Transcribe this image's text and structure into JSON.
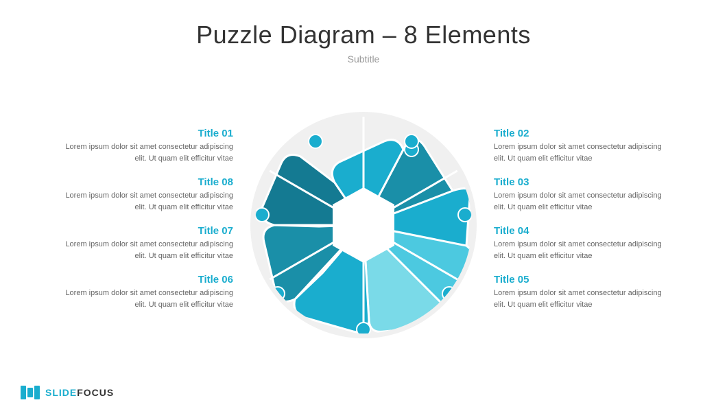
{
  "header": {
    "title": "Puzzle Diagram – 8 Elements",
    "subtitle": "Subtitle"
  },
  "left_items": [
    {
      "title": "Title 01",
      "body": "Lorem ipsum dolor sit amet\nconsectetur adipiscing elit. Ut\nquam elit efficitur vitae"
    },
    {
      "title": "Title 08",
      "body": "Lorem ipsum dolor sit amet\nconsectetur adipiscing elit. Ut\nquam elit efficitur vitae"
    },
    {
      "title": "Title  07",
      "body": "Lorem ipsum dolor sit amet\nconsectetur adipiscing elit. Ut\nquam elit efficitur vitae"
    },
    {
      "title": "Title 06",
      "body": "Lorem ipsum dolor sit amet\nconsectetur adipiscing elit. Ut\nquam elit efficitur vitae"
    }
  ],
  "right_items": [
    {
      "title": "Title 02",
      "body": "Lorem ipsum dolor sit amet\nconsectetur adipiscing elit. Ut\nquam elit efficitur vitae"
    },
    {
      "title": "Title 03",
      "body": "Lorem ipsum dolor sit amet\nconsectetur adipiscing elit. Ut\nquam elit efficitur vitae"
    },
    {
      "title": "Title 04",
      "body": "Lorem ipsum dolor sit amet\nconsectetur adipiscing elit. Ut\nquam elit efficitur vitae"
    },
    {
      "title": "Title  05",
      "body": "Lorem ipsum dolor sit amet\nconsectetur adipiscing elit. Ut\nquam elit efficitur vitae"
    }
  ],
  "footer": {
    "brand_slide": "SLIDE",
    "brand_focus": "FOCUS"
  }
}
